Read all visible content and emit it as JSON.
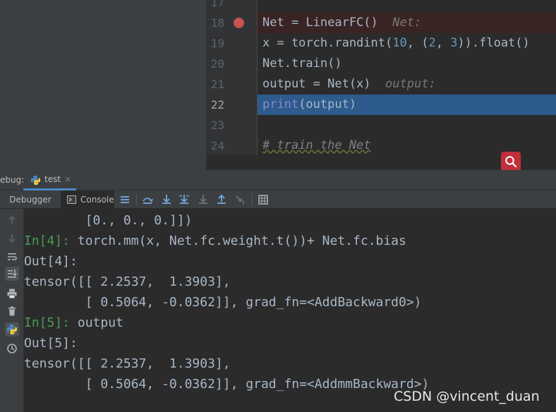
{
  "editor": {
    "lines": [
      {
        "num": "17",
        "code": ""
      },
      {
        "num": "18",
        "code": "Net = LinearFC()",
        "inline": "Net:"
      },
      {
        "num": "19",
        "code_a": "x = torch.randint(",
        "n1": "10",
        "code_b": ", (",
        "n2": "2",
        "code_c": ", ",
        "n3": "3",
        "code_d": ")).float()"
      },
      {
        "num": "20",
        "code": "Net.train()"
      },
      {
        "num": "21",
        "code": "output = Net(x)",
        "inline": "output:"
      },
      {
        "num": "22",
        "kw": "print",
        "code": "(output)"
      },
      {
        "num": "23",
        "code": ""
      },
      {
        "num": "24",
        "code": "# train the Net"
      }
    ]
  },
  "debug": {
    "label": "ebug:",
    "tab": "test",
    "close": "×",
    "toolbar": {
      "debugger": "Debugger",
      "console": "Console"
    }
  },
  "console": {
    "lines": [
      {
        "text": "        [0., 0., 0.]])"
      },
      {
        "prompt": "In[4]:",
        "text": " torch.mm(x, Net.fc.weight.t())+ Net.fc.bias"
      },
      {
        "text": "Out[4]:"
      },
      {
        "text": "tensor([[ 2.2537,  1.3903],"
      },
      {
        "text": "        [ 0.5064, -0.0362]], grad_fn=<AddBackward0>)"
      },
      {
        "prompt": "In[5]:",
        "text": " output"
      },
      {
        "text": "Out[5]:"
      },
      {
        "text": "tensor([[ 2.2537,  1.3903],"
      },
      {
        "text": "        [ 0.5064, -0.0362]], grad_fn=<AddmmBackward>)"
      }
    ]
  },
  "watermark": "CSDN @vincent_duan",
  "colors": {
    "breakpoint": "#c75450",
    "current_line": "#2d5b8c",
    "prompt": "#499c54",
    "search_button": "#c0303a"
  },
  "icons": {
    "search": "search-icon",
    "python": "python-icon"
  }
}
